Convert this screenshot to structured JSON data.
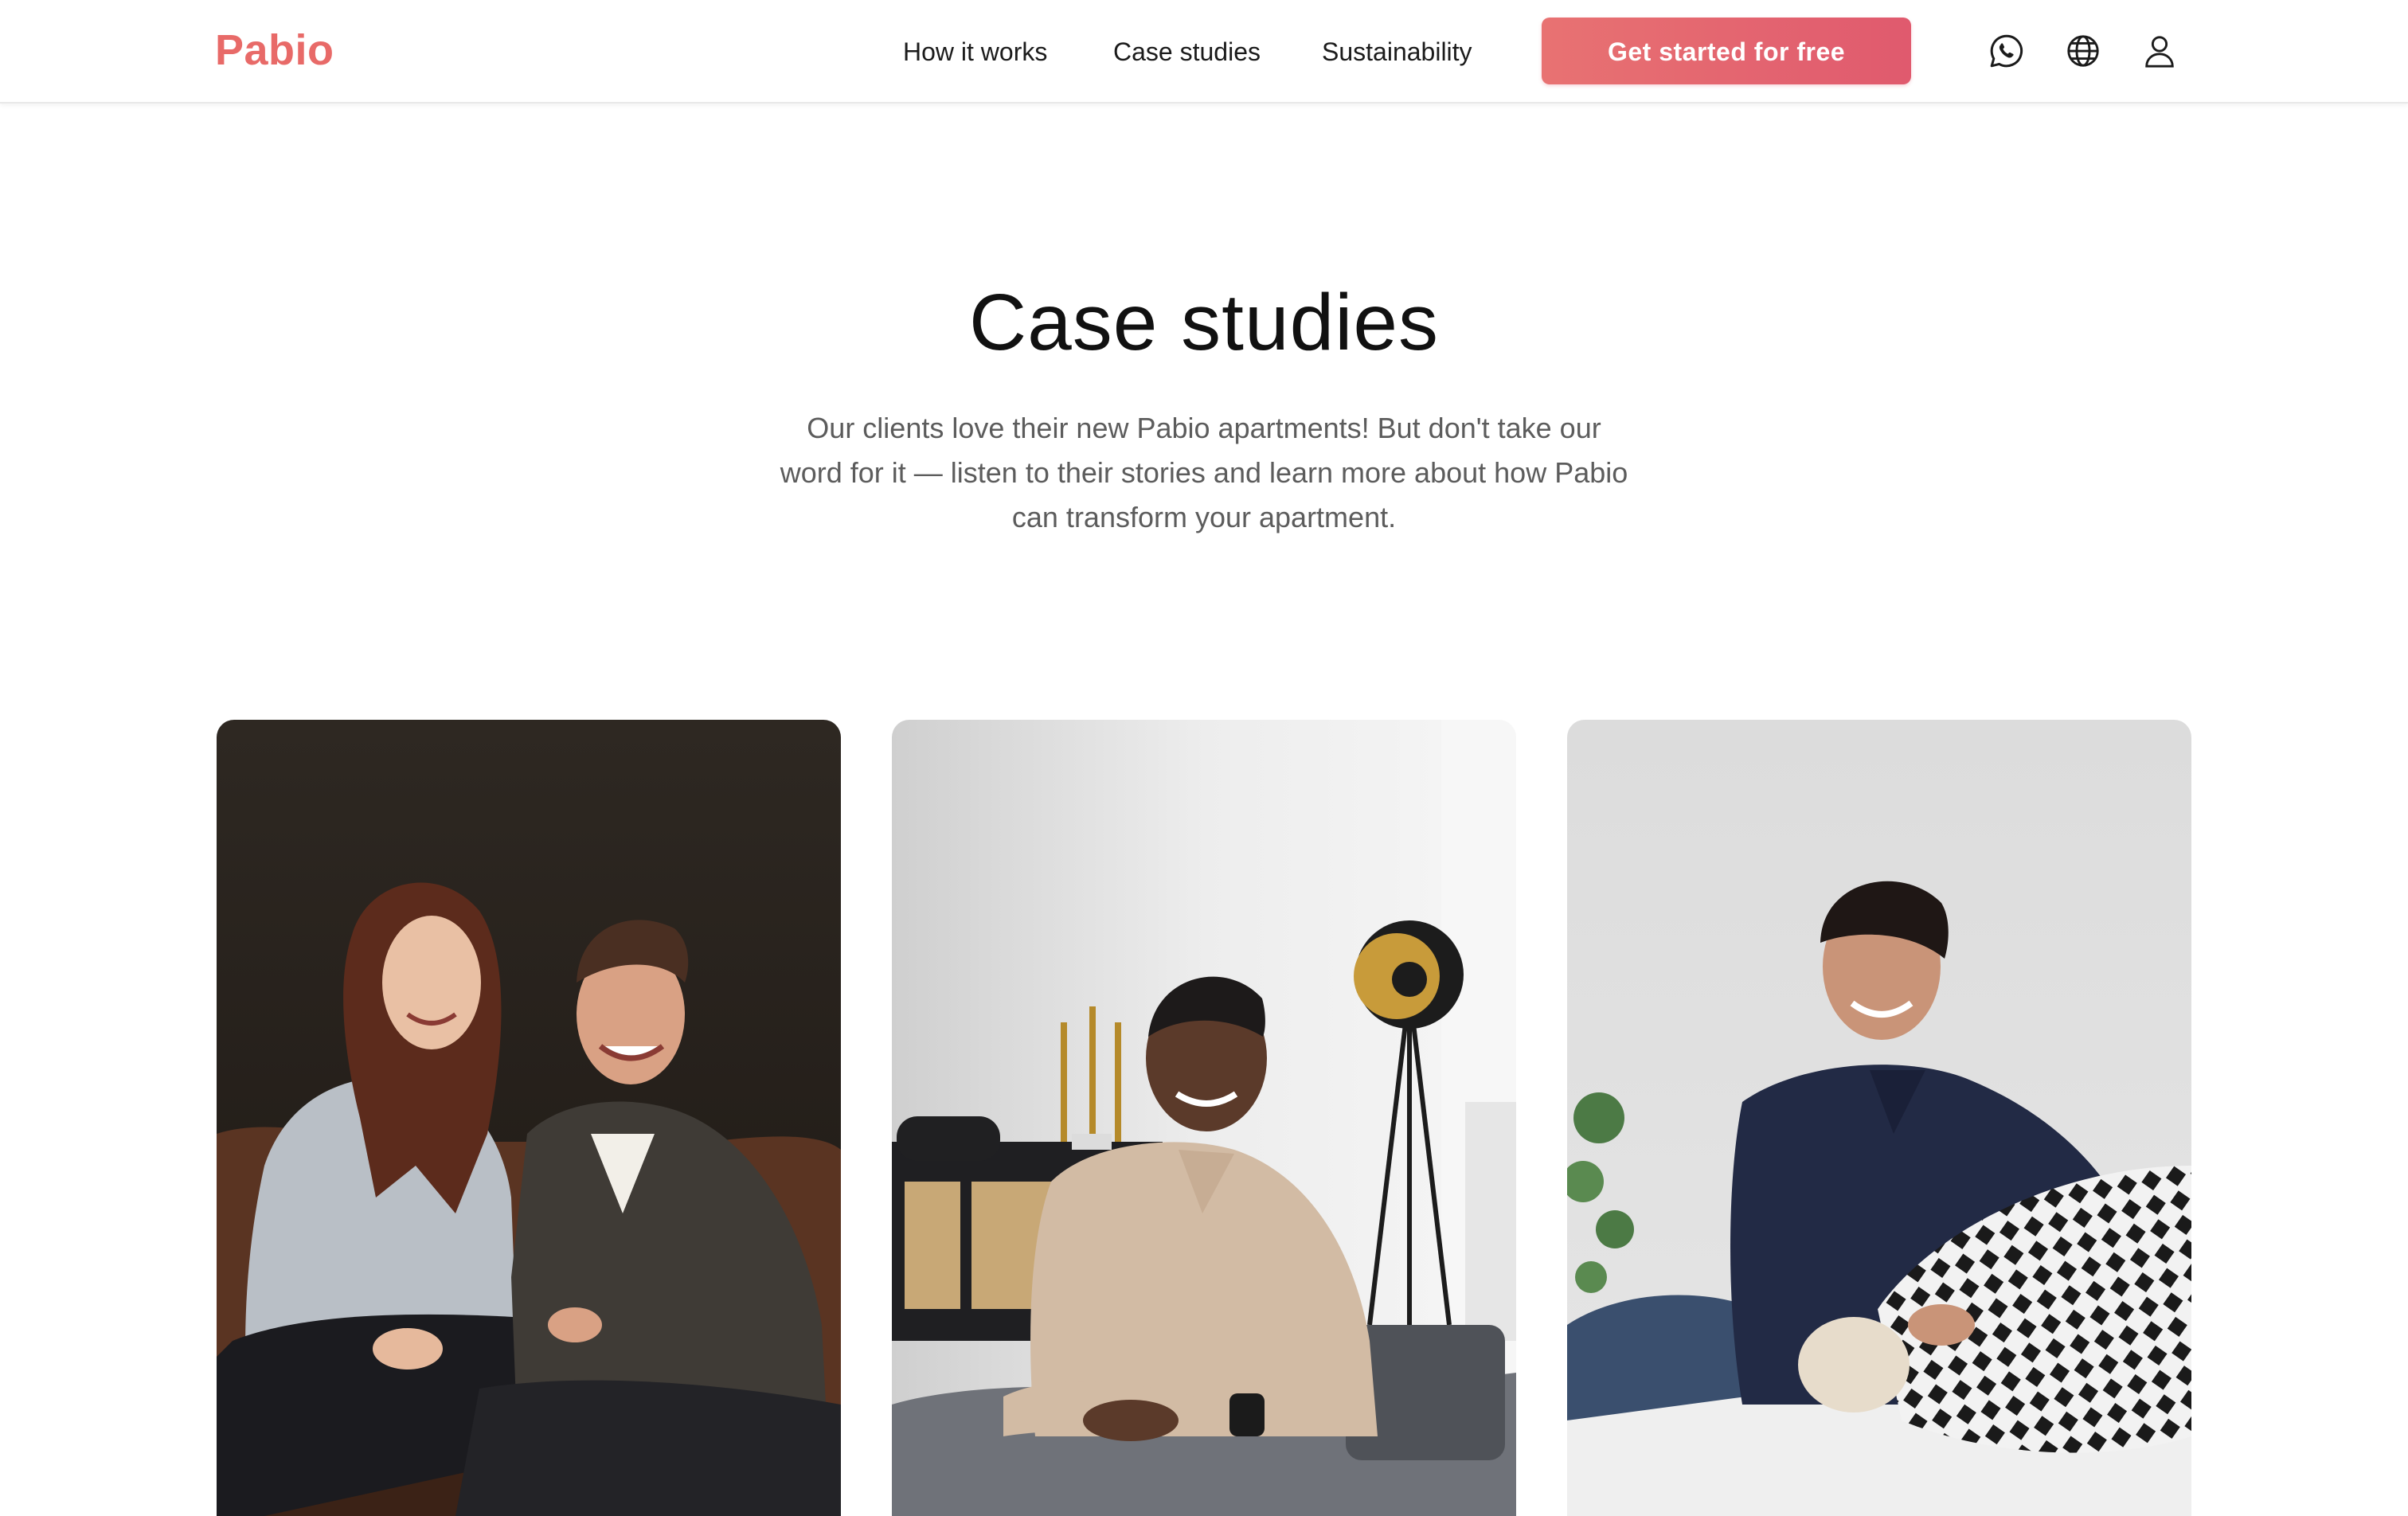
{
  "header": {
    "logo": "Pabio",
    "nav": [
      {
        "label": "How it works"
      },
      {
        "label": "Case studies"
      },
      {
        "label": "Sustainability"
      }
    ],
    "cta_label": "Get started for free",
    "icons": [
      "whatsapp-icon",
      "globe-icon",
      "user-icon"
    ]
  },
  "hero": {
    "title": "Case studies",
    "intro": "Our clients love their new Pabio apartments! But don't take our word for it — listen to their stories and learn more about how Pabio can transform your apartment."
  },
  "cards": [
    {
      "photo": "couple-on-sofa-photo"
    },
    {
      "photo": "man-in-living-room-photo"
    },
    {
      "photo": "man-with-pillow-photo"
    }
  ],
  "colors": {
    "brand": "#e86a68",
    "cta_start": "#e87272",
    "cta_end": "#e05a6e",
    "text": "#111111",
    "muted_text": "#5c5c5c"
  }
}
